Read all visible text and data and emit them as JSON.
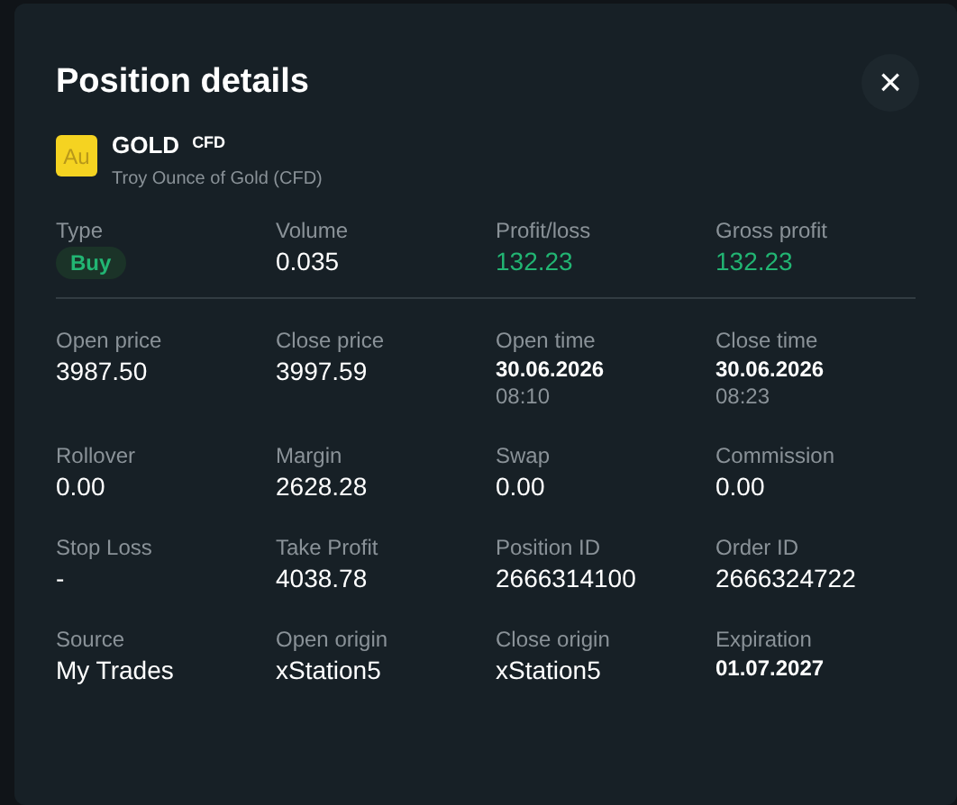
{
  "dialog": {
    "title": "Position details",
    "close": "×"
  },
  "instrument": {
    "icon_text": "Au",
    "symbol": "GOLD",
    "tag": "CFD",
    "description": "Troy Ounce of Gold (CFD)"
  },
  "summary": [
    {
      "label": "Type",
      "value": "Buy",
      "kind": "badge",
      "color": "#22b573"
    },
    {
      "label": "Volume",
      "value": "0.035",
      "kind": "text",
      "color": "#ffffff"
    },
    {
      "label": "Profit/loss",
      "value": "132.23",
      "kind": "text",
      "color": "#22b573"
    },
    {
      "label": "Gross profit",
      "value": "132.23",
      "kind": "text",
      "color": "#22b573"
    }
  ],
  "details": [
    {
      "label": "Open price",
      "value": "3987.50",
      "kind": "text"
    },
    {
      "label": "Close price",
      "value": "3997.59",
      "kind": "text"
    },
    {
      "label": "Open time",
      "value": "30.06.2026",
      "sub": "08:10",
      "kind": "date"
    },
    {
      "label": "Close time",
      "value": "30.06.2026",
      "sub": "08:23",
      "kind": "date"
    },
    {
      "label": "Rollover",
      "value": "0.00",
      "kind": "text"
    },
    {
      "label": "Margin",
      "value": "2628.28",
      "kind": "text"
    },
    {
      "label": "Swap",
      "value": "0.00",
      "kind": "text"
    },
    {
      "label": "Commission",
      "value": "0.00",
      "kind": "text"
    },
    {
      "label": "Stop Loss",
      "value": "-",
      "kind": "text"
    },
    {
      "label": "Take Profit",
      "value": "4038.78",
      "kind": "text"
    },
    {
      "label": "Position ID",
      "value": "2666314100",
      "kind": "text"
    },
    {
      "label": "Order ID",
      "value": "2666324722",
      "kind": "text"
    },
    {
      "label": "Source",
      "value": "My Trades",
      "kind": "text"
    },
    {
      "label": "Open origin",
      "value": "xStation5",
      "kind": "text"
    },
    {
      "label": "Close origin",
      "value": "xStation5",
      "kind": "text"
    },
    {
      "label": "Expiration",
      "value": "01.07.2027",
      "kind": "date"
    }
  ]
}
